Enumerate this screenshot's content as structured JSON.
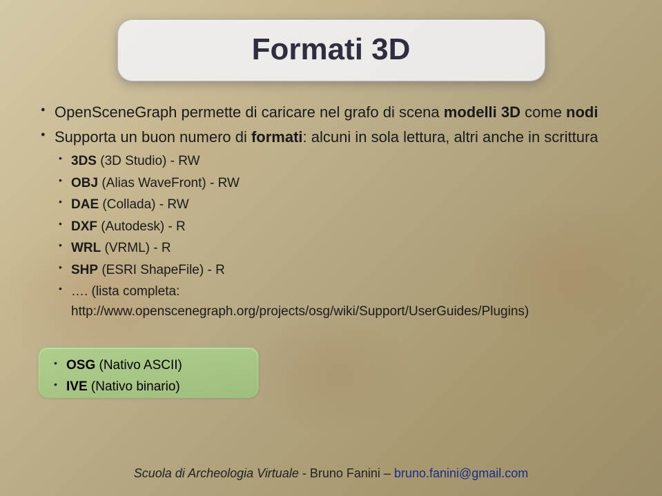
{
  "title": "Formati 3D",
  "intro": [
    "OpenSceneGraph permette di caricare nel grafo di scena ",
    "modelli 3D",
    " come ",
    "nodi"
  ],
  "supporta_prefix": "Supporta un buon numero di ",
  "supporta_bold": "formati",
  "supporta_suffix": ": alcuni in sola lettura, altri anche in scrittura",
  "formats": [
    {
      "name": "3DS",
      "desc": " (3D Studio) - RW"
    },
    {
      "name": "OBJ",
      "desc": " (Alias WaveFront) - RW"
    },
    {
      "name": "DAE",
      "desc": " (Collada) - RW"
    },
    {
      "name": "DXF",
      "desc": " (Autodesk) - R"
    },
    {
      "name": "WRL",
      "desc": " (VRML) - R"
    },
    {
      "name": "SHP",
      "desc": " (ESRI ShapeFile) - R"
    }
  ],
  "complete_list_prefix": "…. (lista completa: ",
  "complete_list_url": "http://www.openscenegraph.org/projects/osg/wiki/Support/UserGuides/Plugins",
  "complete_list_suffix": ")",
  "native": [
    {
      "name": "OSG",
      "desc": " (Nativo ASCII)"
    },
    {
      "name": "IVE",
      "desc": " (Nativo binario)"
    }
  ],
  "footer": {
    "school": "Scuola di Archeologia Virtuale",
    "sep": " - ",
    "author": "Bruno Fanini",
    "dash": " – ",
    "email": "bruno.fanini@gmail.com"
  }
}
